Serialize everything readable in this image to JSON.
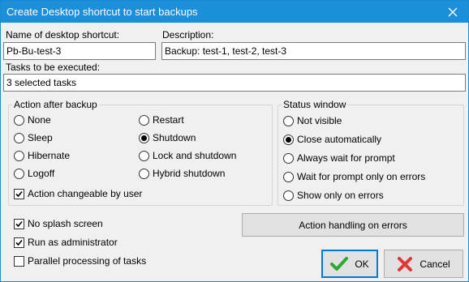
{
  "window": {
    "title": "Create Desktop shortcut to start backups"
  },
  "fields": {
    "name_label": "Name of desktop shortcut:",
    "name_value": "Pb-Bu-test-3",
    "desc_label": "Description:",
    "desc_value": "Backup: test-1, test-2, test-3",
    "tasks_label": "Tasks to be executed:",
    "tasks_value": "3 selected tasks"
  },
  "action_group": {
    "title": "Action after backup",
    "options": [
      "None",
      "Sleep",
      "Hibernate",
      "Logoff",
      "Restart",
      "Shutdown",
      "Lock and shutdown",
      "Hybrid shutdown"
    ],
    "selected": "Shutdown",
    "changeable_label": "Action changeable by user",
    "changeable_checked": true
  },
  "status_group": {
    "title": "Status window",
    "options": [
      "Not visible",
      "Close automatically",
      "Always wait for prompt",
      "Wait for prompt only on errors",
      "Show only on errors"
    ],
    "selected": "Close automatically"
  },
  "checks": {
    "no_splash": "No splash screen",
    "no_splash_checked": true,
    "run_admin": "Run as administrator",
    "run_admin_checked": true,
    "parallel": "Parallel processing of tasks",
    "parallel_checked": false
  },
  "buttons": {
    "error_handling": "Action handling on errors",
    "ok": "OK",
    "cancel": "Cancel"
  },
  "colors": {
    "titlebar": "#1b8fd9",
    "ok_icon": "#2ea82e",
    "cancel_icon": "#e23434"
  }
}
